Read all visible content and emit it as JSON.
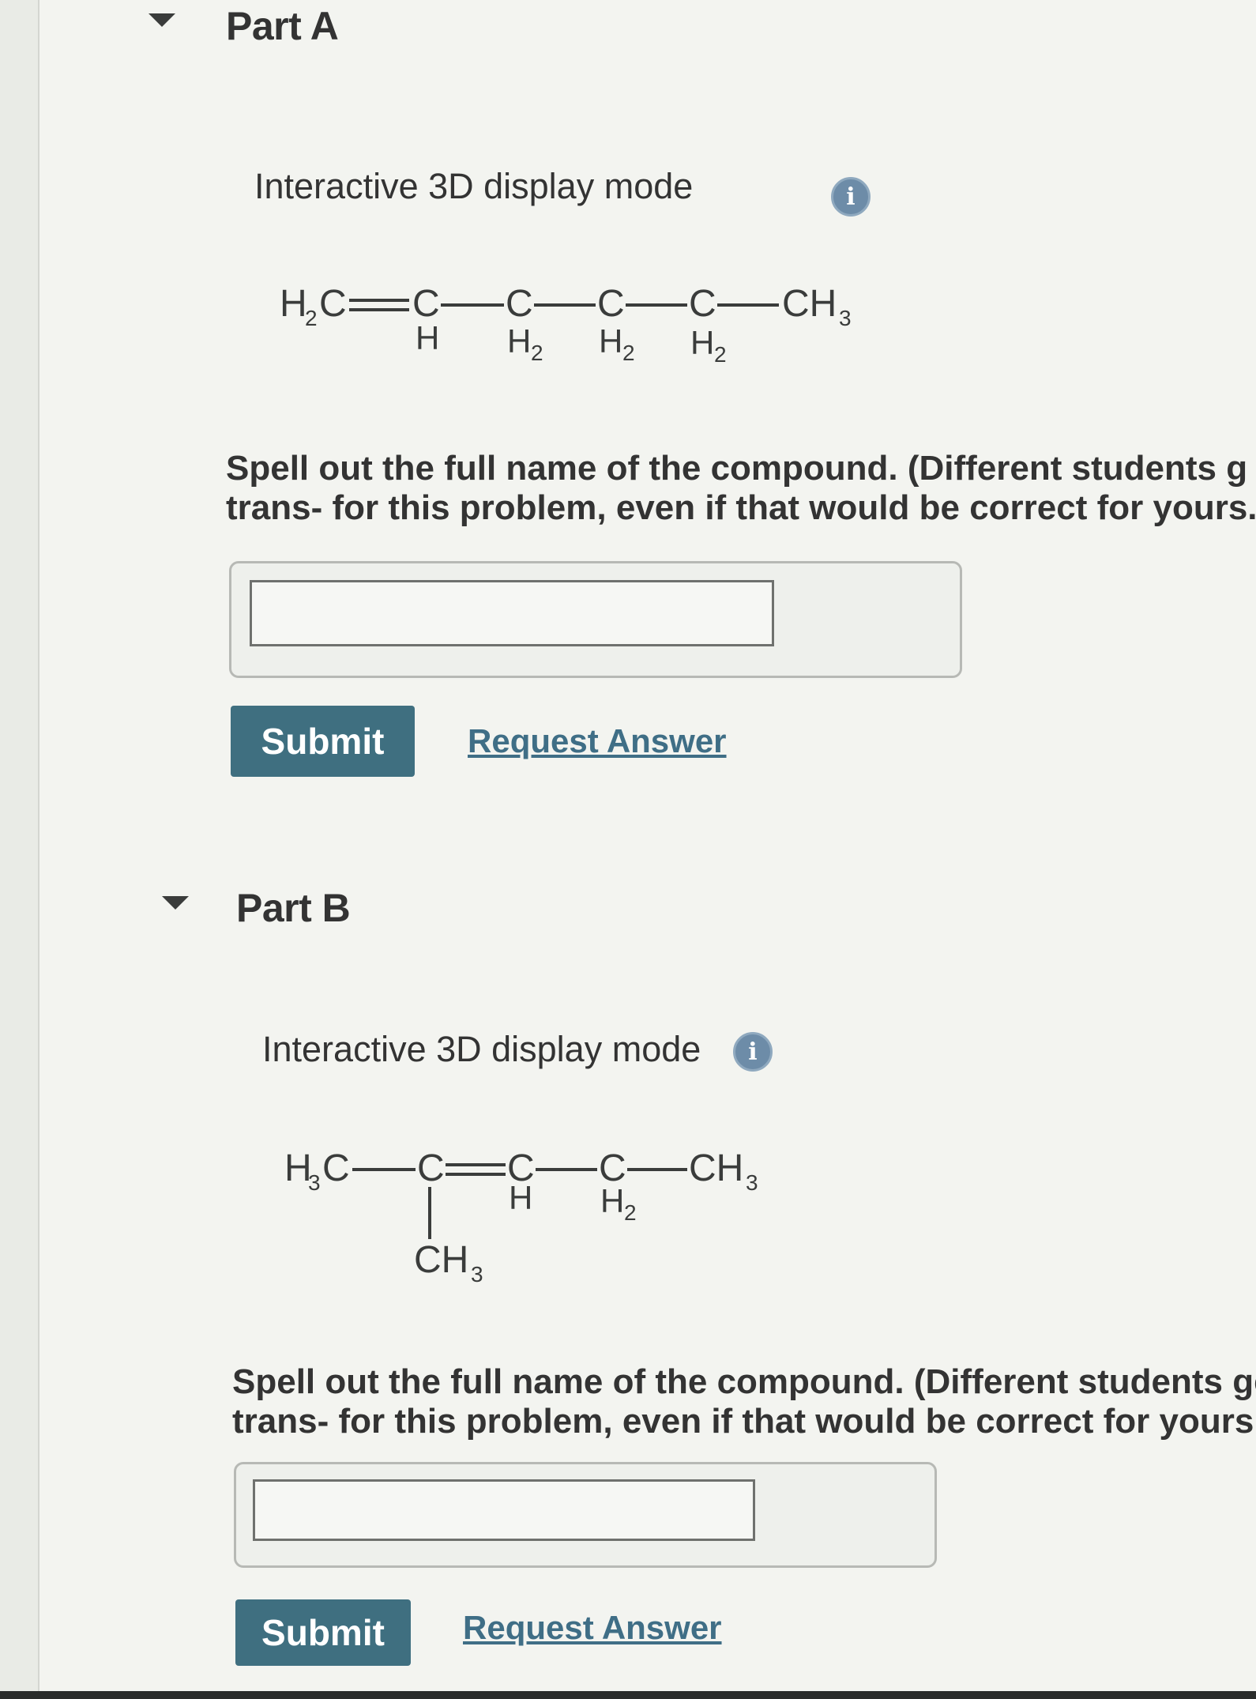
{
  "part_a": {
    "title": "Part A",
    "display_mode": "Interactive 3D display mode",
    "info_icon_glyph": "i",
    "question": [
      "Spell out the full name of the compound. (Different students g",
      "trans- for this problem, even if that would be correct for yours."
    ],
    "answer_value": "",
    "submit_label": "Submit",
    "request_label": "Request Answer",
    "molecule": {
      "atoms": [
        "H",
        "2",
        "C",
        "C",
        "H",
        "C",
        "H",
        "2",
        "C",
        "H",
        "2",
        "C",
        "H",
        "2",
        "CH",
        "3"
      ]
    }
  },
  "part_b": {
    "title": "Part B",
    "display_mode": "Interactive 3D display mode",
    "info_icon_glyph": "i",
    "question": [
      "Spell out the full name of the compound. (Different students get",
      "trans- for this problem, even if that would be correct for yours. --I"
    ],
    "answer_value": "",
    "submit_label": "Submit",
    "request_label": "Request Answer",
    "molecule": {
      "atoms": [
        "H",
        "3",
        "C",
        "C",
        "CH",
        "3",
        "C",
        "H",
        "C",
        "H",
        "2",
        "CH",
        "3"
      ]
    }
  },
  "colors": {
    "submit_bg": "#3f6f80",
    "link": "#3f6e86",
    "info_icon": "#6d8ca8"
  },
  "icons": [
    "collapse-caret-icon",
    "info-icon"
  ]
}
